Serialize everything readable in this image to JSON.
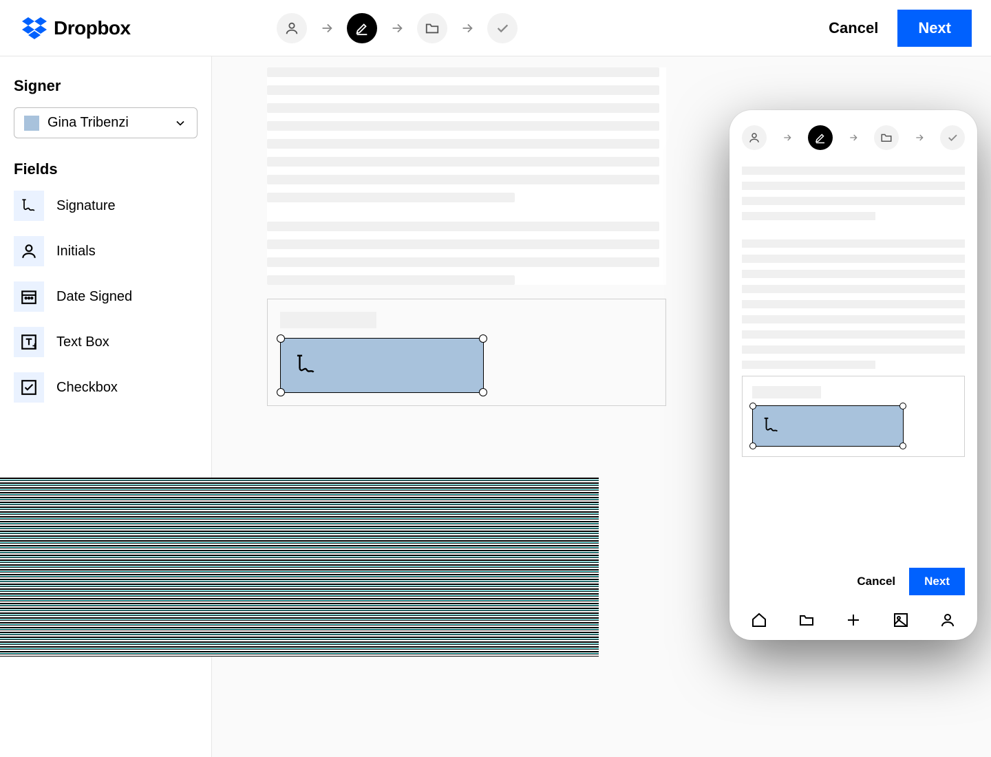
{
  "brand": "Dropbox",
  "topbar": {
    "cancel_label": "Cancel",
    "next_label": "Next"
  },
  "steps": {
    "active_index": 1,
    "icons": [
      "person",
      "edit",
      "folder",
      "check"
    ]
  },
  "sidebar": {
    "signer_heading": "Signer",
    "signer_name": "Gina Tribenzi",
    "signer_color": "#a8c2dc",
    "fields_heading": "Fields",
    "fields": [
      {
        "label": "Signature",
        "icon": "signature"
      },
      {
        "label": "Initials",
        "icon": "person"
      },
      {
        "label": "Date Signed",
        "icon": "date"
      },
      {
        "label": "Text Box",
        "icon": "textbox"
      },
      {
        "label": "Checkbox",
        "icon": "checkbox"
      }
    ]
  },
  "document": {
    "placed_field": {
      "type": "Signature",
      "assigned_to": "Gina Tribenzi",
      "color": "#a8c2dc"
    }
  },
  "mobile": {
    "cancel_label": "Cancel",
    "next_label": "Next",
    "tabbar_icons": [
      "home",
      "folder",
      "plus",
      "image",
      "person"
    ]
  },
  "colors": {
    "primary": "#0061fe",
    "signer_fill": "#a8c2dc",
    "skeleton": "#f0f0f0"
  }
}
